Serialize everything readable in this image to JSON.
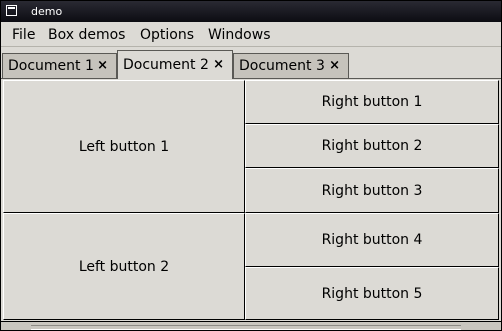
{
  "window": {
    "title": "demo"
  },
  "menu": {
    "items": [
      "File",
      "Box demos",
      "Options",
      "Windows"
    ]
  },
  "tabs": [
    {
      "label": "Document 1",
      "close": "×",
      "active": false
    },
    {
      "label": "Document 2",
      "close": "×",
      "active": true
    },
    {
      "label": "Document 3",
      "close": "×",
      "active": false
    }
  ],
  "left_buttons": [
    "Left button 1",
    "Left button 2"
  ],
  "right_buttons": [
    "Right button 1",
    "Right button 2",
    "Right button 3",
    "Right button 4",
    "Right button 5"
  ],
  "colors": {
    "background": "#dcdad5",
    "inactive_tab": "#c6c3bc",
    "titlebar": "#0c0c12"
  }
}
